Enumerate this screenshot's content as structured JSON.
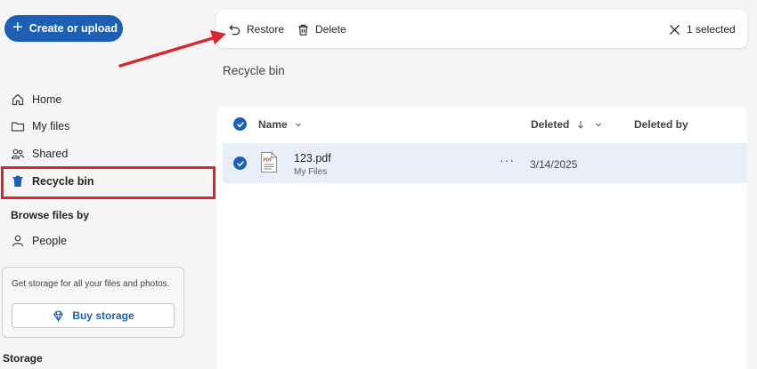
{
  "create_button": {
    "label": "Create or upload"
  },
  "sidebar": {
    "items": [
      {
        "label": "Home"
      },
      {
        "label": "My files"
      },
      {
        "label": "Shared"
      },
      {
        "label": "Recycle bin"
      }
    ],
    "browse_section": "Browse files by",
    "browse_items": [
      {
        "label": "People"
      }
    ],
    "storage_card": {
      "text": "Get storage for all your files and photos.",
      "button_label": "Buy storage"
    },
    "storage_label": "Storage"
  },
  "command_bar": {
    "restore_label": "Restore",
    "delete_label": "Delete",
    "selection_label": "1 selected"
  },
  "page_title": "Recycle bin",
  "table": {
    "columns": [
      "Name",
      "Deleted",
      "Deleted by"
    ],
    "rows": [
      {
        "name": "123.pdf",
        "location": "My Files",
        "deleted": "3/14/2025",
        "deleted_by": "",
        "selected": true,
        "file_icon_text": "PDF"
      }
    ]
  },
  "colors": {
    "accent": "#1c5fb5",
    "annotation": "#d7262e",
    "selected_row": "#e8eff8"
  }
}
